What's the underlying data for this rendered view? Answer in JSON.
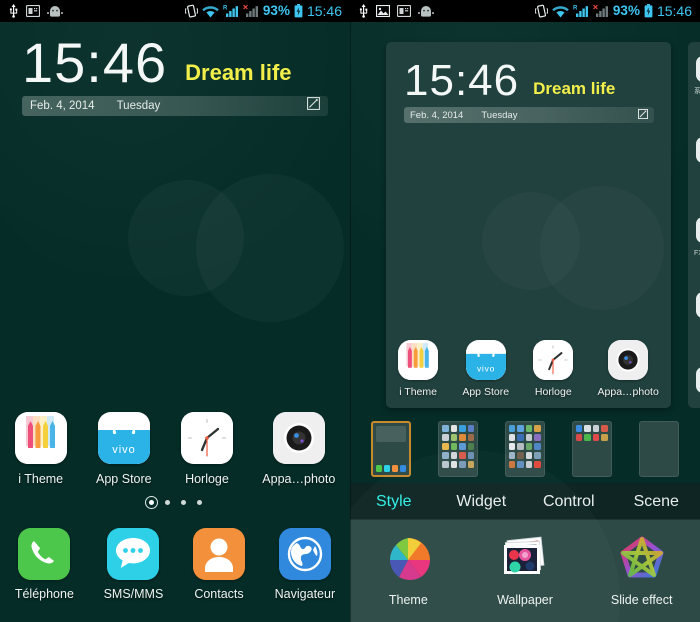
{
  "status_bar": {
    "time": "15:46",
    "battery_percent": "93%",
    "left_icons_left_panel": [
      "usb-icon",
      "sim-card-icon",
      "android-robot-icon"
    ],
    "left_icons_right_panel": [
      "usb-icon",
      "image-icon",
      "sim-card-icon",
      "android-robot-icon"
    ],
    "right_icons": [
      "vibrate-icon",
      "wifi-icon",
      "signal-roaming-icon",
      "signal-no-service-icon",
      "battery-charging-icon"
    ],
    "signal_roaming_badge": "R",
    "signal_error_badge": "x"
  },
  "clock_widget": {
    "time": "15:46",
    "slogan": "Dream life",
    "date": "Feb. 4, 2014",
    "weekday": "Tuesday",
    "edit_icon": "edit-pencil-icon"
  },
  "home": {
    "apps": [
      {
        "label": "i Theme",
        "icon": "i-theme-icon"
      },
      {
        "label": "App Store",
        "icon": "vivo-app-store-icon"
      },
      {
        "label": "Horloge",
        "icon": "clock-icon"
      },
      {
        "label": "Appa…photo",
        "icon": "camera-icon"
      }
    ],
    "dock": [
      {
        "label": "Téléphone",
        "icon": "phone-icon"
      },
      {
        "label": "SMS/MMS",
        "icon": "message-icon"
      },
      {
        "label": "Contacts",
        "icon": "contacts-icon"
      },
      {
        "label": "Navigateur",
        "icon": "browser-globe-icon"
      }
    ],
    "page_dots": {
      "count": 4,
      "active_index": 0
    }
  },
  "editor": {
    "preview_apps": [
      {
        "label": "i Theme",
        "icon": "i-theme-icon"
      },
      {
        "label": "App Store",
        "icon": "vivo-app-store-icon"
      },
      {
        "label": "Horloge",
        "icon": "clock-icon"
      },
      {
        "label": "Appa…photo",
        "icon": "camera-icon"
      }
    ],
    "side_card_labels": [
      "系",
      "FX"
    ],
    "page_thumbnails": [
      {
        "name": "page-1-widget",
        "selected": true
      },
      {
        "name": "page-2-apps",
        "selected": false
      },
      {
        "name": "page-3-apps",
        "selected": false
      },
      {
        "name": "page-4-apps",
        "selected": false
      },
      {
        "name": "page-5-empty",
        "selected": false
      }
    ],
    "tabs": [
      {
        "label": "Style",
        "active": true
      },
      {
        "label": "Widget",
        "active": false
      },
      {
        "label": "Control",
        "active": false
      },
      {
        "label": "Scene",
        "active": false
      }
    ],
    "options": [
      {
        "label": "Theme",
        "icon": "theme-palette-icon"
      },
      {
        "label": "Wallpaper",
        "icon": "wallpaper-photos-icon"
      },
      {
        "label": "Slide effect",
        "icon": "slide-effect-star-icon"
      }
    ]
  },
  "colors": {
    "wallpaper": "#052c27",
    "panel_card": "#21413e",
    "tabbar": "#0e2523",
    "optbar": "#2d4a47",
    "accent_cyan": "#2ff0e6",
    "slogan_yellow": "#f2ef4a",
    "status_blue": "#3ec6f0",
    "thumb_selected": "#c98a2e"
  }
}
